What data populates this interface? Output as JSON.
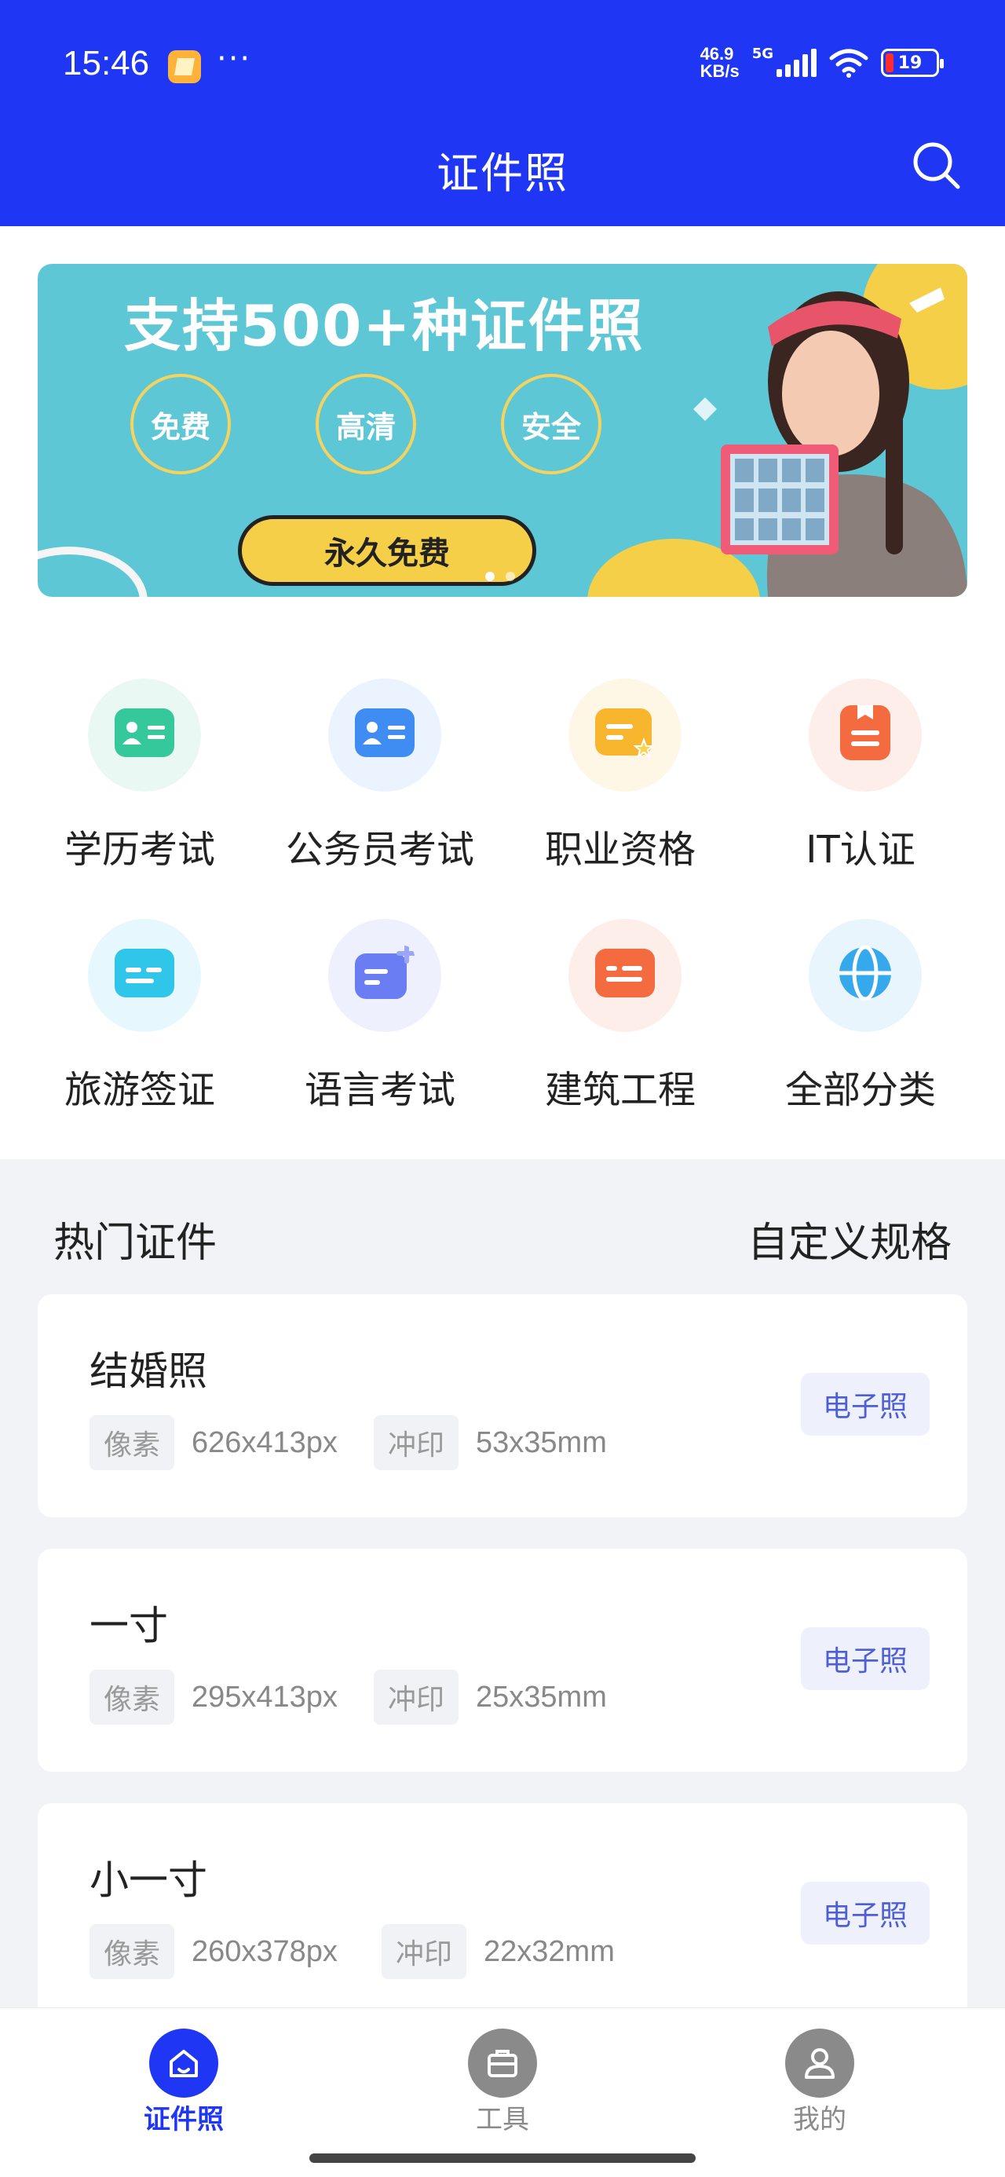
{
  "status_bar": {
    "time": "15:46",
    "more": "···",
    "net_speed_value": "46.9",
    "net_speed_unit": "KB/s",
    "network_type": "5G",
    "battery": "19"
  },
  "header": {
    "title": "证件照"
  },
  "banner": {
    "title": "支持500+种证件照",
    "features": [
      "免费",
      "高清",
      "安全"
    ],
    "cta": "永久免费",
    "active_slide": 1,
    "slide_count": 2
  },
  "categories": [
    {
      "label": "学历考试",
      "icon": "id-card-icon",
      "color": "#34c89a",
      "bg": "#e9f8f2"
    },
    {
      "label": "公务员考试",
      "icon": "badge-icon",
      "color": "#3f8cf3",
      "bg": "#eaf3fe"
    },
    {
      "label": "职业资格",
      "icon": "certificate-star-icon",
      "color": "#f7b62d",
      "bg": "#fef7e6"
    },
    {
      "label": "IT认证",
      "icon": "bookmark-icon",
      "color": "#f36b3f",
      "bg": "#feeeea"
    },
    {
      "label": "旅游签证",
      "icon": "visa-card-icon",
      "color": "#2fc6ea",
      "bg": "#e6f8fd"
    },
    {
      "label": "语言考试",
      "icon": "message-plus-icon",
      "color": "#6b7df2",
      "bg": "#eef0fe"
    },
    {
      "label": "建筑工程",
      "icon": "building-card-icon",
      "color": "#f36b3f",
      "bg": "#feeeea"
    },
    {
      "label": "全部分类",
      "icon": "globe-icon",
      "color": "#36a8ec",
      "bg": "#e8f5fd"
    }
  ],
  "hot": {
    "title": "热门证件",
    "custom_link": "自定义规格",
    "items": [
      {
        "name": "结婚照",
        "pixel_label": "像素",
        "pixel": "626x413px",
        "print_label": "冲印",
        "print": "53x35mm",
        "button": "电子照"
      },
      {
        "name": "一寸",
        "pixel_label": "像素",
        "pixel": "295x413px",
        "print_label": "冲印",
        "print": "25x35mm",
        "button": "电子照"
      },
      {
        "name": "小一寸",
        "pixel_label": "像素",
        "pixel": "260x378px",
        "print_label": "冲印",
        "print": "22x32mm",
        "button": "电子照"
      }
    ]
  },
  "bottom_nav": [
    {
      "label": "证件照",
      "icon": "home-icon",
      "active": true
    },
    {
      "label": "工具",
      "icon": "toolbox-icon",
      "active": false
    },
    {
      "label": "我的",
      "icon": "user-icon",
      "active": false
    }
  ],
  "colors": {
    "primary": "#1f36f5",
    "banner_bg": "#5ec7d6",
    "accent_yellow": "#f6cf48",
    "button_text": "#4e5fd6"
  }
}
